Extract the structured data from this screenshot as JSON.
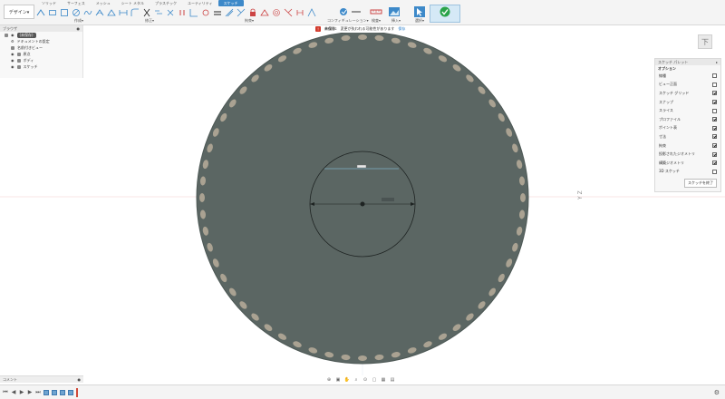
{
  "toolbar": {
    "design_label": "デザイン▾",
    "tabs": [
      "ソリッド",
      "サーフェス",
      "メッシュ",
      "シート メタル",
      "プラスチック",
      "ユーティリティ",
      "スケッチ"
    ],
    "active_tab": "スケッチ",
    "group_labels": {
      "create": "作成▾",
      "modify": "修正▾",
      "constrain": "拘束▾",
      "config": "コンフィギュレーション▾",
      "inspect": "検査▾",
      "insert": "挿入▾",
      "select": "選択▾",
      "finish": "スケッチを終了▾"
    }
  },
  "warning": {
    "label": "未保存:",
    "message": "変更が失われる可能性があります",
    "action": "保存"
  },
  "browser": {
    "title": "ブラウザ",
    "items": [
      {
        "label": "(未保存)"
      },
      {
        "label": "ドキュメントの設定"
      },
      {
        "label": "名前付きビュー"
      },
      {
        "label": "原点"
      },
      {
        "label": "ボディ"
      },
      {
        "label": "スケッチ"
      }
    ]
  },
  "viewcube": {
    "label": "下"
  },
  "palette": {
    "title": "スケッチ パレット",
    "section": "オプション",
    "rows": [
      {
        "label": "線種",
        "checked": false
      },
      {
        "label": "ビュー正面",
        "checked": false
      },
      {
        "label": "スケッチ グリッド",
        "checked": true
      },
      {
        "label": "スナップ",
        "checked": true
      },
      {
        "label": "スライス",
        "checked": false
      },
      {
        "label": "プロファイル",
        "checked": true
      },
      {
        "label": "ポイント表",
        "checked": true
      },
      {
        "label": "寸法",
        "checked": true
      },
      {
        "label": "拘束",
        "checked": true
      },
      {
        "label": "投影されたジオメトリ",
        "checked": true
      },
      {
        "label": "構築ジオメトリ",
        "checked": true
      },
      {
        "label": "3D スケッチ",
        "checked": false
      }
    ],
    "finish_label": "スケッチを終了"
  },
  "comments": {
    "label": "コメント"
  },
  "colors": {
    "gear_body": "#5b6663",
    "teeth": "#b8ad9a",
    "accent": "#3d89c9"
  }
}
